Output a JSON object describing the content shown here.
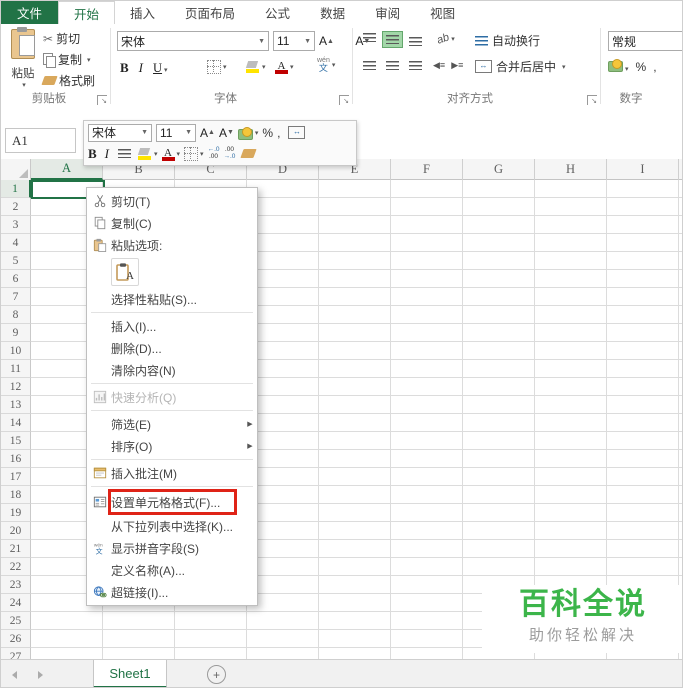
{
  "colors": {
    "excel_green": "#217346",
    "highlight_red": "#df2317",
    "watermark_green": "#3cb54a",
    "active_toggle_green": "#a2d7a8"
  },
  "tab_bar": {
    "file_label": "文件",
    "tabs": [
      "开始",
      "插入",
      "页面布局",
      "公式",
      "数据",
      "审阅",
      "视图"
    ],
    "active_tab": "开始"
  },
  "ribbon": {
    "clipboard": {
      "paste_label": "粘贴",
      "cut_label": "剪切",
      "copy_label": "复制",
      "format_painter_label": "格式刷",
      "group_label": "剪贴板"
    },
    "font": {
      "font_name": "宋体",
      "font_size": "11",
      "bold_label": "B",
      "italic_label": "I",
      "underline_label": "U",
      "grow_font_label": "A",
      "shrink_font_label": "A",
      "font_color_label": "A",
      "phonetic_top": "wén",
      "phonetic_bottom": "文",
      "group_label": "字体"
    },
    "alignment": {
      "orientation_label": "ab",
      "wrap_text_label": "自动换行",
      "merge_center_label": "合并后居中",
      "group_label": "对齐方式"
    },
    "number": {
      "format_value": "常规",
      "percent_label": "%",
      "comma_label": ",",
      "group_label": "数字"
    }
  },
  "formula_bar": {
    "name_box_value": "A1"
  },
  "mini_toolbar": {
    "font_name": "宋体",
    "font_size": "11",
    "grow_font_label": "A",
    "shrink_font_label": "A",
    "bold_label": "B",
    "italic_label": "I",
    "font_color_label": "A",
    "percent_label": "%",
    "comma_label": ",",
    "decrease_decimal_label": "←.0",
    "decrease_decimal_label2": ".00",
    "increase_decimal_label": ".00",
    "increase_decimal_label2": "→.0"
  },
  "context_menu": {
    "items": [
      {
        "type": "item",
        "icon": "cut-icon",
        "label": "剪切(T)"
      },
      {
        "type": "item",
        "icon": "copy-icon",
        "label": "复制(C)"
      },
      {
        "type": "item",
        "icon": "paste-icon",
        "label": "粘贴选项:"
      },
      {
        "type": "paste-options",
        "icon": "paste-keep-formatting-icon"
      },
      {
        "type": "item",
        "label": "选择性粘贴(S)..."
      },
      {
        "type": "separator"
      },
      {
        "type": "item",
        "label": "插入(I)..."
      },
      {
        "type": "item",
        "label": "删除(D)..."
      },
      {
        "type": "item",
        "label": "清除内容(N)"
      },
      {
        "type": "separator"
      },
      {
        "type": "item",
        "icon": "quick-analysis-icon",
        "label": "快速分析(Q)",
        "disabled": true
      },
      {
        "type": "separator"
      },
      {
        "type": "item",
        "label": "筛选(E)",
        "submenu": true
      },
      {
        "type": "item",
        "label": "排序(O)",
        "submenu": true
      },
      {
        "type": "separator"
      },
      {
        "type": "item",
        "icon": "comment-icon",
        "label": "插入批注(M)"
      },
      {
        "type": "separator"
      },
      {
        "type": "item",
        "icon": "format-cells-icon",
        "label": "设置单元格格式(F)...",
        "highlighted": true
      },
      {
        "type": "item",
        "label": "从下拉列表中选择(K)..."
      },
      {
        "type": "item",
        "icon": "phonetic-icon",
        "label": "显示拼音字段(S)"
      },
      {
        "type": "item",
        "label": "定义名称(A)..."
      },
      {
        "type": "item",
        "icon": "hyperlink-icon",
        "label": "超链接(I)..."
      }
    ]
  },
  "grid": {
    "columns": [
      "A",
      "B",
      "C",
      "D",
      "E",
      "F",
      "G",
      "H",
      "I"
    ],
    "rows": [
      "1",
      "2",
      "3",
      "4",
      "5",
      "6",
      "7",
      "8",
      "9",
      "10",
      "11",
      "12",
      "13",
      "14",
      "15",
      "16",
      "17",
      "18",
      "19",
      "20",
      "21",
      "22",
      "23",
      "24",
      "25",
      "26",
      "27"
    ],
    "selected_cell": "A1",
    "selected_column": "A",
    "selected_row": "1"
  },
  "sheet_bar": {
    "sheet_tabs": [
      {
        "label": "Sheet1",
        "active": true
      }
    ],
    "add_sheet_label": "+"
  },
  "watermark": {
    "title": "百科全说",
    "subtitle": "助你轻松解决"
  }
}
